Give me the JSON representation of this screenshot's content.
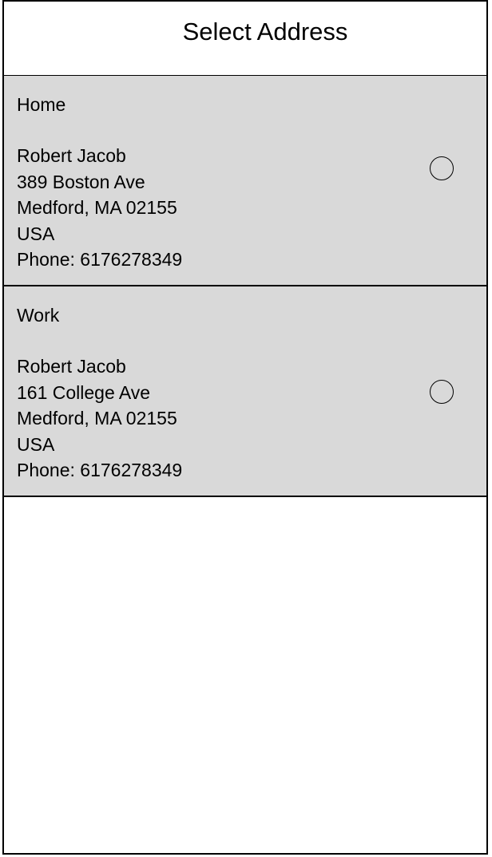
{
  "header": {
    "title": "Select Address"
  },
  "addresses": [
    {
      "label": "Home",
      "name": "Robert Jacob",
      "street": "389 Boston Ave",
      "city_line": "Medford, MA 02155",
      "country": "USA",
      "phone": "Phone: 6176278349",
      "selected": false
    },
    {
      "label": "Work",
      "name": "Robert Jacob",
      "street": "161 College Ave",
      "city_line": "Medford, MA 02155",
      "country": "USA",
      "phone": "Phone: 6176278349",
      "selected": false
    }
  ],
  "colors": {
    "card_background": "#d9d9d9",
    "border": "#000000",
    "page_background": "#ffffff"
  }
}
